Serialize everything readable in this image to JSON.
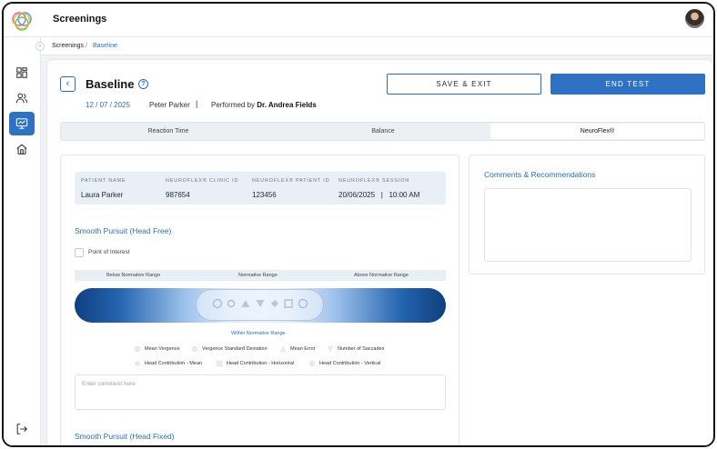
{
  "app": {
    "title": "Screenings"
  },
  "breadcrumb": {
    "items": [
      "Screenings",
      "Baseline"
    ],
    "separator": "/"
  },
  "header": {
    "title": "Baseline",
    "date": "12 / 07 / 2025",
    "patient": "Peter Parker",
    "divider": "|",
    "performed_prefix": "Performed by",
    "performed_by": "Dr. Andrea Fields",
    "save_exit_label": "SAVE & EXIT",
    "end_test_label": "END TEST"
  },
  "tabs": [
    {
      "label": "Reaction Time",
      "active": false
    },
    {
      "label": "Balance",
      "active": false
    },
    {
      "label": "NeuroFlex®",
      "active": true
    }
  ],
  "info": {
    "headers": [
      "PATIENT NAME",
      "NEUROFLEX® CLINIC ID",
      "NEUROFLEX® PATIENT ID",
      "NEUROFLEX® SESSION"
    ],
    "values": [
      "Laura Parker",
      "987654",
      "123456",
      "20/06/2025   |   10:00 AM"
    ]
  },
  "section1": {
    "title": "Smooth Pursuit (Head Free)",
    "checkbox_label": "Point of Interest",
    "ranges": [
      "Below Normative Range",
      "Normative Range",
      "Above Normative Range"
    ],
    "within_label": "Within Normative Range",
    "legend": [
      {
        "label": "Mean Vergence",
        "icon": "circle"
      },
      {
        "label": "Vergence Standard Deviation",
        "icon": "circle"
      },
      {
        "label": "Mean Error",
        "icon": "triangle-up"
      },
      {
        "label": "Number of Saccades",
        "icon": "triangle-down"
      },
      {
        "label": "Head Contribution - Mean",
        "icon": "diamond"
      },
      {
        "label": "Head Contribution - Horizontal",
        "icon": "square"
      },
      {
        "label": "Head Contribution - Vertical",
        "icon": "circle"
      }
    ],
    "comment_placeholder": "Enter comment here"
  },
  "section2": {
    "title": "Smooth Pursuit (Head Fixed)"
  },
  "comments": {
    "title": "Comments & Recommendations"
  },
  "colors": {
    "accent": "#2f72c4",
    "link": "#2a6fb8",
    "gauge_dark": "#0f3f80"
  }
}
